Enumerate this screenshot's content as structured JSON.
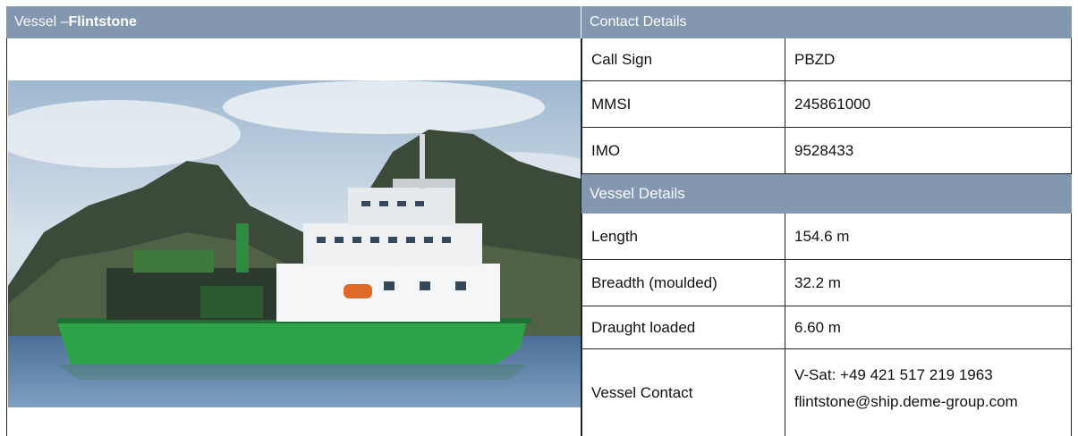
{
  "vessel_header": {
    "prefix": "Vessel – ",
    "name": "Flintstone"
  },
  "contact_header": "Contact Details",
  "contact_rows": [
    {
      "label": "Call Sign",
      "value": "PBZD"
    },
    {
      "label": "MMSI",
      "value": "245861000"
    },
    {
      "label": "IMO",
      "value": "9528433"
    }
  ],
  "vessel_details_header": "Vessel Details",
  "vessel_rows": [
    {
      "label": "Length",
      "value": "154.6 m"
    },
    {
      "label": "Breadth (moulded)",
      "value": "32.2 m"
    },
    {
      "label": "Draught loaded",
      "value": "6.60 m"
    }
  ],
  "vessel_contact": {
    "label": "Vessel Contact",
    "vsat": "V-Sat: +49 421 517 219 1963",
    "email": "flintstone@ship.deme-group.com"
  },
  "colors": {
    "header_band": "#8497b0",
    "hull_green": "#2fa34a"
  }
}
